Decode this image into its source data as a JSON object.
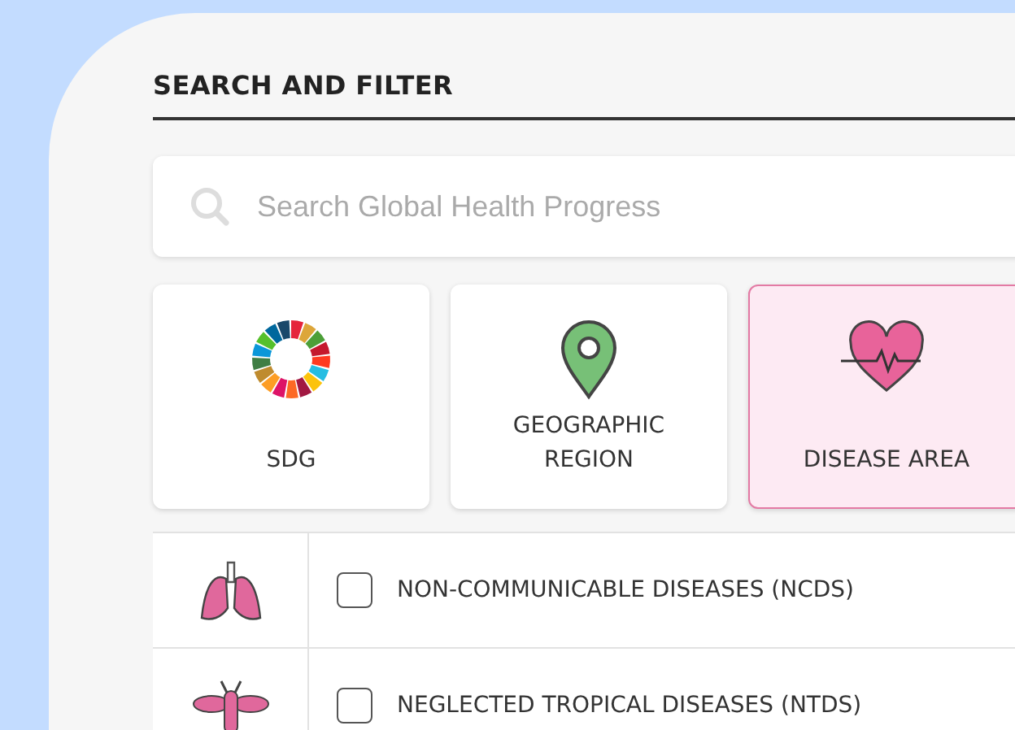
{
  "section": {
    "title": "SEARCH AND FILTER"
  },
  "search": {
    "placeholder": "Search Global Health Progress"
  },
  "filters": [
    {
      "kind": "sdg",
      "label": "SDG",
      "selected": false
    },
    {
      "kind": "region",
      "label": "GEOGRAPHIC REGION",
      "selected": false
    },
    {
      "kind": "disease",
      "label": "DISEASE AREA",
      "selected": true
    }
  ],
  "categories": [
    {
      "kind": "lungs",
      "label": "NON-COMMUNICABLE DISEASES (NCDS)",
      "checked": false
    },
    {
      "kind": "mosquito",
      "label": "NEGLECTED TROPICAL DISEASES (NTDS)",
      "checked": false
    }
  ]
}
